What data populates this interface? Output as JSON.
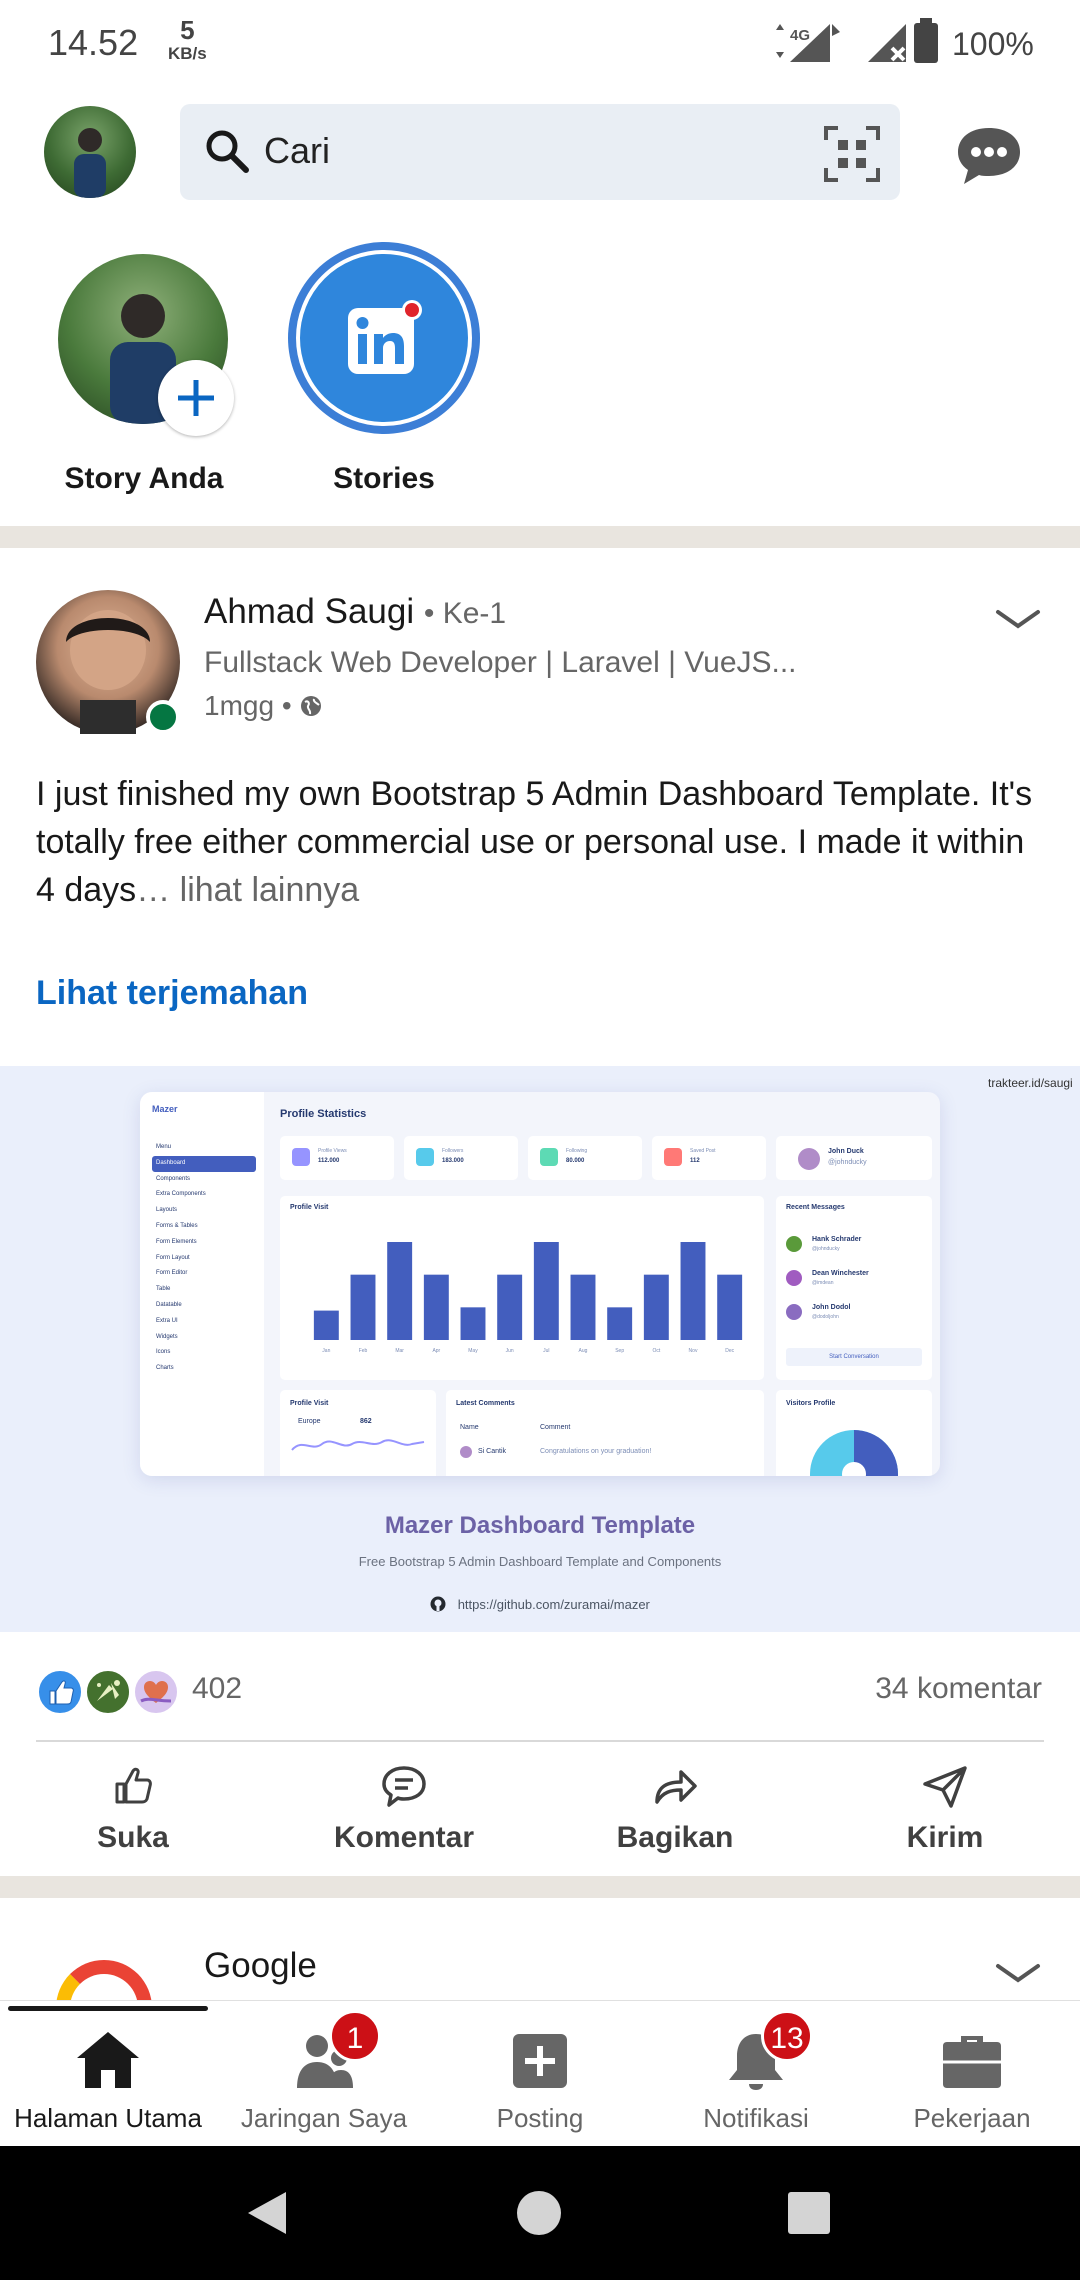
{
  "status_bar": {
    "time": "14.52",
    "speed_value": "5",
    "speed_unit": "KB/s",
    "network": "4G",
    "battery": "100%"
  },
  "top_bar": {
    "search_placeholder": "Cari"
  },
  "stories": [
    {
      "label": "Story Anda"
    },
    {
      "label": "Stories"
    }
  ],
  "post": {
    "author": "Ahmad Saugi",
    "degree": "• Ke-1",
    "headline": "Fullstack Web Developer | Laravel | VueJS...",
    "time": "1mgg •",
    "text": "I just finished my own Bootstrap 5 Admin Dashboard Template. It's totally free either commercial use or personal use.  I made it within 4 days",
    "ellipsis": "…",
    "see_more": " lihat lainnya",
    "translate": "Lihat terjemahan",
    "preview": {
      "watermark": "trakteer.id/saugi",
      "title": "Mazer Dashboard Template",
      "subtitle": "Free Bootstrap 5 Admin Dashboard Template and Components",
      "link": "https://github.com/zuramai/mazer",
      "dash_brand": "Mazer",
      "dash_heading": "Profile Statistics",
      "dash_menu": [
        "Menu",
        "Dashboard",
        "Components",
        "Extra Components",
        "Layouts",
        "Forms & Tables",
        "Form Elements",
        "Form Layout",
        "Form Editor",
        "Table",
        "Datatable",
        "Extra UI",
        "Widgets",
        "Icons",
        "Charts"
      ],
      "dash_stats": [
        {
          "label": "Profile Views",
          "value": "112.000",
          "color": "#9694ff"
        },
        {
          "label": "Followers",
          "value": "183.000",
          "color": "#57caeb"
        },
        {
          "label": "Following",
          "value": "80.000",
          "color": "#5ddab4"
        },
        {
          "label": "Saved Post",
          "value": "112",
          "color": "#ff7976"
        }
      ],
      "dash_user": {
        "name": "John Duck",
        "handle": "@johnducky"
      },
      "dash_chart_title": "Profile Visit",
      "dash_chart_values": [
        9,
        20,
        30,
        20,
        10,
        20,
        30,
        20,
        10,
        20,
        30,
        20
      ],
      "dash_chart_months": [
        "Jan",
        "Feb",
        "Mar",
        "Apr",
        "May",
        "Jun",
        "Jul",
        "Aug",
        "Sep",
        "Oct",
        "Nov",
        "Dec"
      ],
      "dash_messages_title": "Recent Messages",
      "dash_messages": [
        {
          "name": "Hank Schrader",
          "handle": "@johnducky"
        },
        {
          "name": "Dean Winchester",
          "handle": "@imdean"
        },
        {
          "name": "John Dodol",
          "handle": "@dodoljohn"
        }
      ],
      "dash_start_btn": "Start Conversation",
      "dash_bottom_left": "Profile Visit",
      "dash_bottom_europe": "Europe",
      "dash_bottom_europe_val": "862",
      "dash_comments_title": "Latest Comments",
      "dash_comments_cols": [
        "Name",
        "Comment"
      ],
      "dash_comment_row": {
        "name": "Si Cantik",
        "text": "Congratulations on your graduation!"
      },
      "dash_visitors": "Visitors Profile"
    },
    "reactions": {
      "count": "402",
      "comments": "34 komentar"
    },
    "actions": [
      {
        "label": "Suka"
      },
      {
        "label": "Komentar"
      },
      {
        "label": "Bagikan"
      },
      {
        "label": "Kirim"
      }
    ]
  },
  "next_post": {
    "author": "Google"
  },
  "bottom_nav": [
    {
      "label": "Halaman Utama"
    },
    {
      "label": "Jaringan Saya",
      "badge": "1"
    },
    {
      "label": "Posting"
    },
    {
      "label": "Notifikasi",
      "badge": "13"
    },
    {
      "label": "Pekerjaan"
    }
  ]
}
